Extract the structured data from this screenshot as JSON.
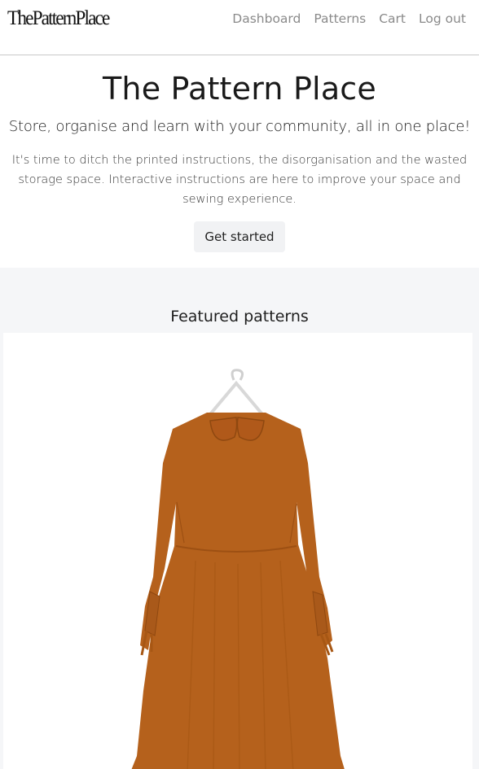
{
  "navbar": {
    "brand": "ThePatternPlace",
    "links": [
      "Dashboard",
      "Patterns",
      "Cart",
      "Log out"
    ]
  },
  "hero": {
    "title": "The Pattern Place",
    "lead": "Store, organise and learn with your community, all in one place!",
    "description": "It's time to ditch the printed instructions, the disorganisation and the wasted storage space. Interactive instructions are here to improve your space and sewing experience.",
    "cta_label": "Get started"
  },
  "featured": {
    "heading": "Featured patterns",
    "items": [
      {
        "image": "rust-linen-dress-on-hanger",
        "color": "#b5611c"
      }
    ]
  }
}
